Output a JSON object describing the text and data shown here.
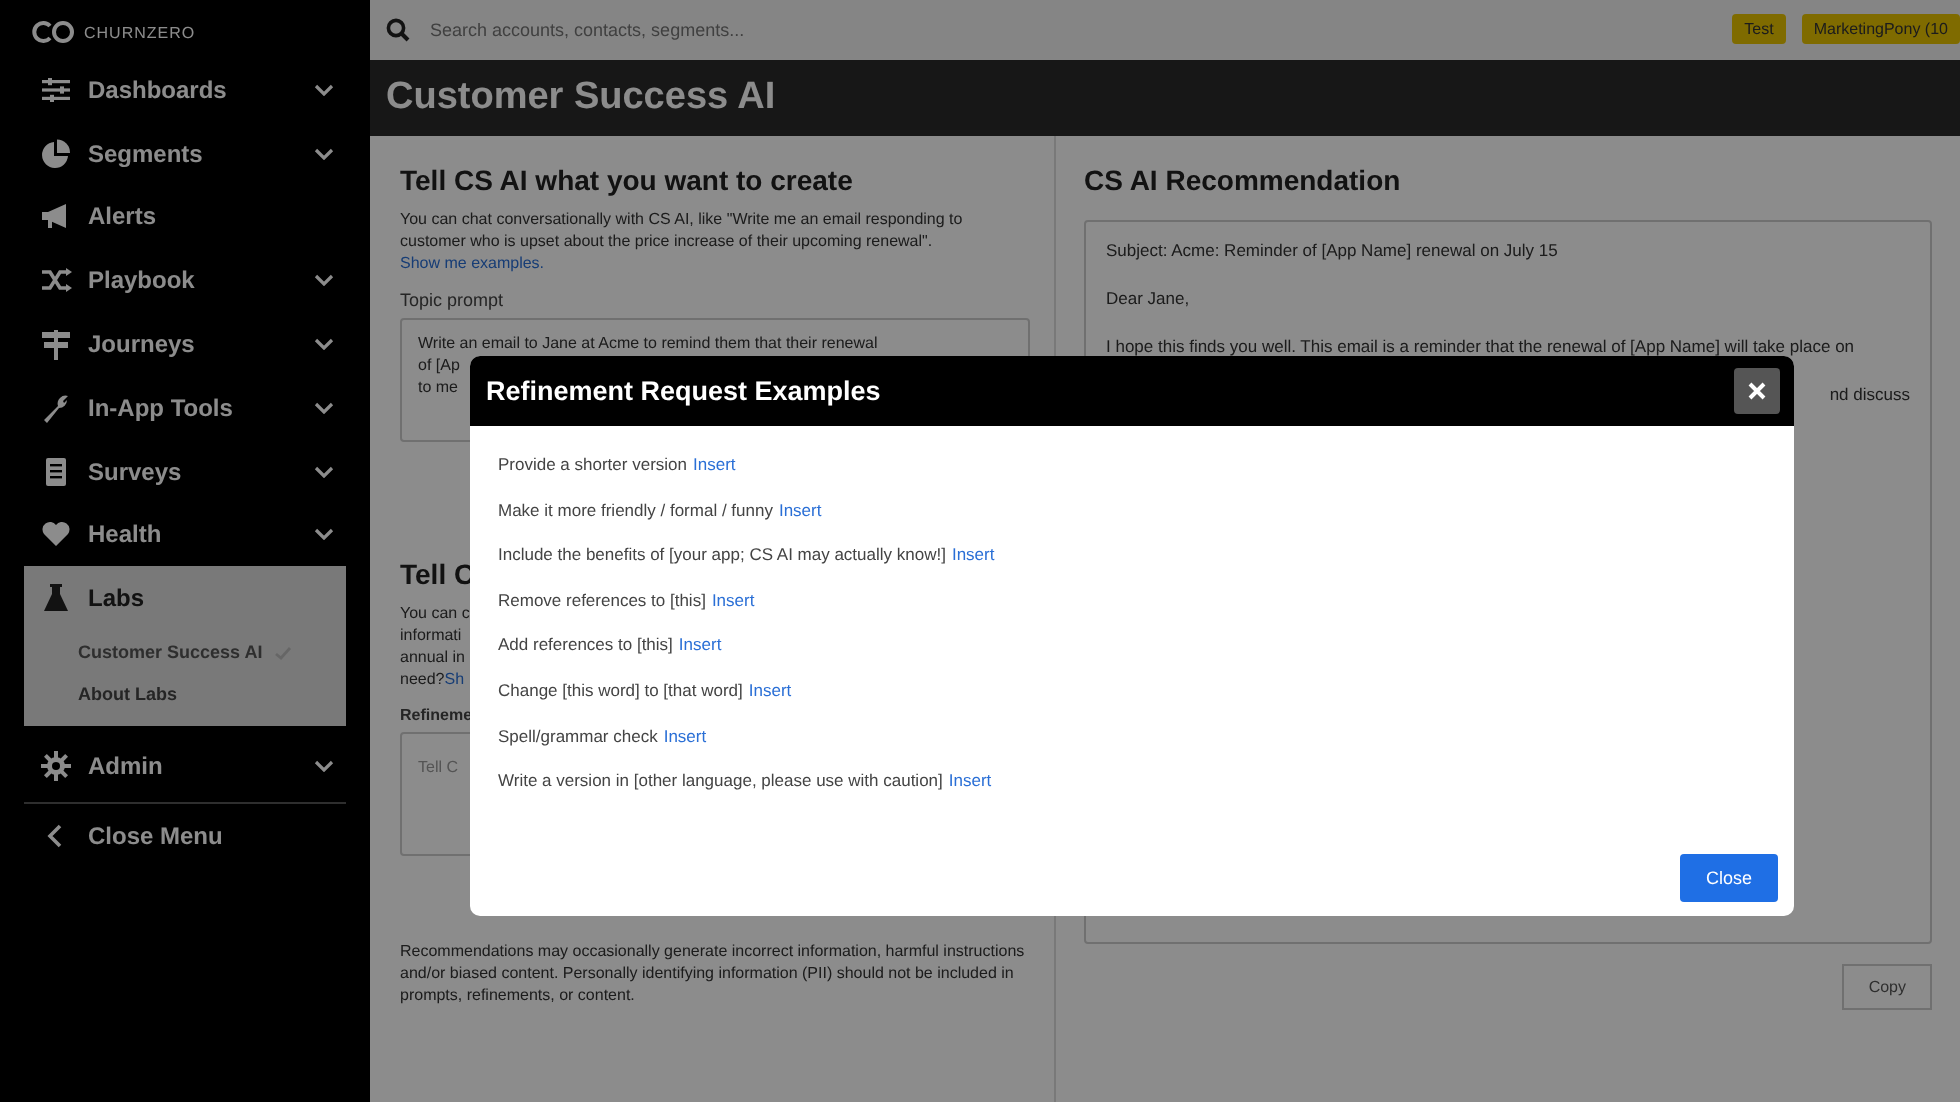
{
  "brand": "CHURNZERO",
  "sidebar": {
    "items": [
      {
        "label": "Dashboards",
        "chevron": true
      },
      {
        "label": "Segments",
        "chevron": true
      },
      {
        "label": "Alerts",
        "chevron": false
      },
      {
        "label": "Playbook",
        "chevron": true
      },
      {
        "label": "Journeys",
        "chevron": true
      },
      {
        "label": "In-App Tools",
        "chevron": true
      },
      {
        "label": "Surveys",
        "chevron": true
      },
      {
        "label": "Health",
        "chevron": true
      },
      {
        "label": "Labs",
        "chevron": false,
        "children": [
          {
            "label": "Customer Success AI",
            "selected": true
          },
          {
            "label": "About Labs",
            "selected": false
          }
        ]
      },
      {
        "label": "Admin",
        "chevron": true
      }
    ],
    "close_menu": "Close Menu"
  },
  "search": {
    "placeholder": "Search accounts, contacts, segments..."
  },
  "badges": [
    {
      "label": "Test"
    },
    {
      "label": "MarketingPony (10"
    }
  ],
  "page_title": "Customer Success AI",
  "create_section": {
    "heading": "Tell CS AI what you want to create",
    "intro": "You can chat conversationally with CS AI, like \"Write me an email responding to customer who is upset about the price increase of their upcoming renewal\".",
    "intro_link": "Show me examples.",
    "prompt_label": "Topic prompt",
    "prompt_lines": [
      "Write an email to Jane at Acme to remind them that their renewal",
      "of [Ap",
      "to me"
    ]
  },
  "refine_section": {
    "heading": "Tell C",
    "intro_lines": [
      "You can c",
      "informati",
      "annual in",
      "need?"
    ],
    "intro_link": "Sh",
    "label": "Refineme",
    "placeholder": "Tell C"
  },
  "disclaimer": "Recommendations may occasionally generate incorrect information, harmful instructions and/or biased content. Personally identifying information (PII) should not be included in prompts, refinements, or content.",
  "recommendation": {
    "heading": "CS AI Recommendation",
    "lines": [
      "Subject: Acme: Reminder of [App Name] renewal on July 15",
      "Dear Jane,",
      "I hope this finds you well. This email is a reminder that the renewal of [App Name] will take place on"
    ],
    "cut_line": "nd discuss",
    "copy": "Copy"
  },
  "modal": {
    "title": "Refinement Request Examples",
    "items": [
      {
        "text": "Provide a shorter version",
        "action": "Insert"
      },
      {
        "text": "Make it more friendly / formal / funny",
        "action": "Insert"
      },
      {
        "text": "Include the benefits of [your app; CS AI may actually know!]",
        "action": "Insert"
      },
      {
        "text": "Remove references to [this]",
        "action": "Insert"
      },
      {
        "text": "Add references to [this]",
        "action": "Insert"
      },
      {
        "text": "Change [this word] to [that word]",
        "action": "Insert"
      },
      {
        "text": "Spell/grammar check",
        "action": "Insert"
      },
      {
        "text": "Write a version in [other language, please use with caution]",
        "action": "Insert"
      }
    ],
    "close": "Close"
  }
}
